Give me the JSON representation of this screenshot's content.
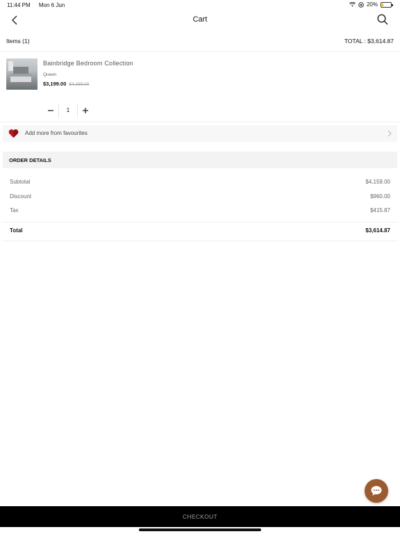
{
  "status_bar": {
    "time": "11:44 PM",
    "date": "Mon 6 Jun",
    "battery": "20%",
    "battery_level": 0.2
  },
  "header": {
    "title": "Cart"
  },
  "summary": {
    "items_label": "Items (1)",
    "total_label": "TOTAL :",
    "total_value": "$3,614.87"
  },
  "cart_items": [
    {
      "name": "Bainbridge Bedroom Collection",
      "variant": "Queen",
      "price": "$3,199.00",
      "original_price": "$4,159.00",
      "quantity": "1"
    }
  ],
  "favourites": {
    "label": "Add more from favourites"
  },
  "order_details": {
    "title": "ORDER DETAILS",
    "lines": [
      {
        "label": "Subtotal",
        "value": "$4,159.00"
      },
      {
        "label": "Discount",
        "value": "$960.00"
      },
      {
        "label": "Tax",
        "value": "$415.87"
      }
    ],
    "total": {
      "label": "Total",
      "value": "$3,614.87"
    }
  },
  "checkout": {
    "label": "CHECKOUT"
  },
  "colors": {
    "chat_button": "#9b5a2f",
    "heart": "#b3171d",
    "checkout_bg": "#000000"
  }
}
